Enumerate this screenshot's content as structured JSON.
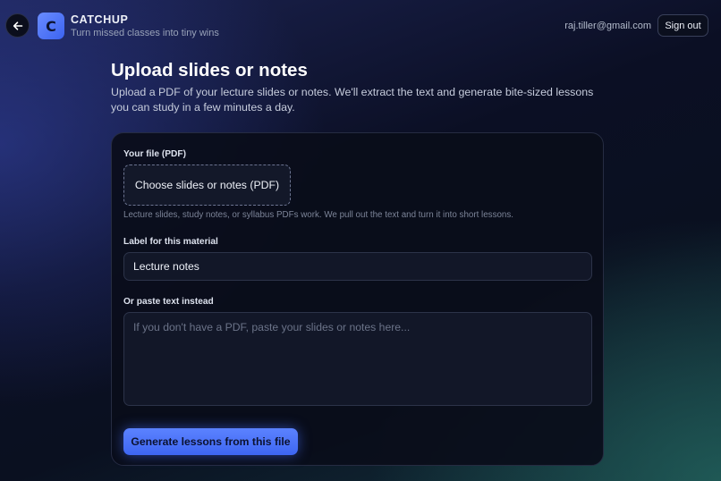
{
  "header": {
    "back_icon": "arrow-left-icon",
    "logo_letter": "C",
    "app_name": "CATCHUP",
    "tagline": "Turn missed classes into tiny wins",
    "user_email": "raj.tiller@gmail.com",
    "signout_label": "Sign out"
  },
  "page": {
    "title": "Upload slides or notes",
    "description": "Upload a PDF of your lecture slides or notes. We'll extract the text and generate bite-sized lessons you can study in a few minutes a day."
  },
  "form": {
    "file_label": "Your file (PDF)",
    "file_button": "Choose slides or notes (PDF)",
    "file_hint": "Lecture slides, study notes, or syllabus PDFs work. We pull out the text and turn it into short lessons.",
    "material_label": "Label for this material",
    "material_value": "Lecture notes",
    "paste_label": "Or paste text instead",
    "paste_placeholder": "If you don't have a PDF, paste your slides or notes here...",
    "paste_value": "",
    "submit_label": "Generate lessons from this file"
  },
  "colors": {
    "accent": "#4f76fb",
    "card_bg": "#0a0d1a",
    "input_bg": "#121728"
  }
}
